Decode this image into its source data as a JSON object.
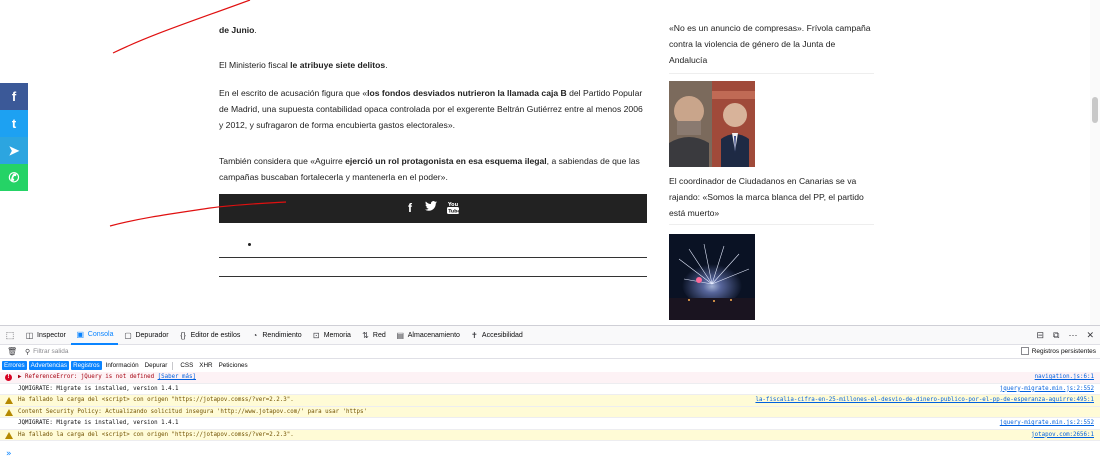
{
  "article": {
    "p1_bold": "de Junio",
    "p1_tail": ".",
    "p2_pre": "El Ministerio fiscal ",
    "p2_bold": "le atribuye siete delitos",
    "p2_tail": ".",
    "p3_pre": "En el escrito de acusación figura que «",
    "p3_bold": "los fondos desviados nutrieron la llamada caja B",
    "p3_tail": " del Partido Popular de Madrid, una supuesta contabilidad opaca controlada por el exgerente Beltrán Gutiérrez entre al menos 2006 y 2012, y sufragaron de forma encubierta gastos electorales».",
    "p4_pre": "También considera que «Aguirre ",
    "p4_bold": "ejerció un rol protagonista en esa esquema ilegal",
    "p4_tail": ", a sabiendas de que las campañas buscaban fortalecerla y mantenerla en el poder»."
  },
  "share_bar": {
    "facebook": "f",
    "twitter": "🐦",
    "youtube": "▶"
  },
  "social": {
    "facebook": "f",
    "twitter": "t",
    "telegram": "➤",
    "whatsapp": "✆"
  },
  "sidebar": {
    "item1": "«No es un anuncio de compresas». Frívola campaña contra la violencia de género de la Junta de Andalucía",
    "item2": "El coordinador de Ciudadanos en Canarias se va rajando: «Somos la marca blanca del PP, el partido está muerto»"
  },
  "devtools": {
    "tabs": [
      {
        "label": "Inspector",
        "icon": "inspector-icon"
      },
      {
        "label": "Consola",
        "icon": "console-icon"
      },
      {
        "label": "Depurador",
        "icon": "debugger-icon"
      },
      {
        "label": "Editor de estilos",
        "icon": "style-editor-icon"
      },
      {
        "label": "Rendimiento",
        "icon": "performance-icon"
      },
      {
        "label": "Memoria",
        "icon": "memory-icon"
      },
      {
        "label": "Red",
        "icon": "network-icon"
      },
      {
        "label": "Almacenamiento",
        "icon": "storage-icon"
      },
      {
        "label": "Accesibilidad",
        "icon": "accessibility-icon"
      }
    ],
    "active_tab": "Consola",
    "filter_placeholder": "Filtrar salida",
    "persist_label": "Registros persistentes",
    "levels": [
      "Errores",
      "Advertencias",
      "Registros",
      "Información",
      "Depurar"
    ],
    "types": [
      "CSS",
      "XHR",
      "Peticiones"
    ],
    "messages": [
      {
        "kind": "err",
        "text": "▶ ReferenceError: jQuery is not defined ",
        "more": "[Saber más]",
        "source": "navigation.js:6:1"
      },
      {
        "kind": "log-plain",
        "text": "JQMIGRATE: Migrate is installed, version 1.4.1",
        "more": "",
        "source": "jquery-migrate.min.js:2:552"
      },
      {
        "kind": "warn",
        "text": "Ha fallado la carga del <script> con origen \"https://jotapov.comss/?ver=2.2.3\".",
        "more": "",
        "source": "la-fiscalia-cifra-en-25-millones-el-desvio-de-dinero-publico-por-el-pp-de-esperanza-aguirre:495:1"
      },
      {
        "kind": "warn",
        "text": "Content Security Policy: Actualizando solicitud insegura 'http://www.jotapov.com/' para usar 'https'",
        "more": "",
        "source": ""
      },
      {
        "kind": "log-plain",
        "text": "JQMIGRATE: Migrate is installed, version 1.4.1",
        "more": "",
        "source": "jquery-migrate.min.js:2:552"
      },
      {
        "kind": "warn",
        "text": "Ha fallado la carga del <script> con origen \"https://jotapov.comss/?ver=2.2.3\".",
        "more": "",
        "source": "jotapov.com:2656:1"
      }
    ],
    "prompt": "»"
  }
}
